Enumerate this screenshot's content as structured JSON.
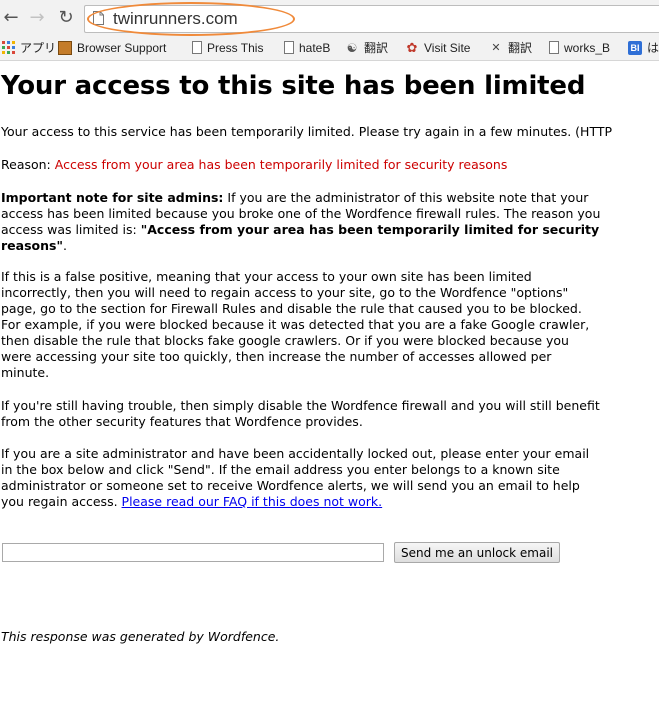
{
  "browser": {
    "url": "twinrunners.com",
    "bookmarks": [
      {
        "label": "アプリ",
        "icon": "apps-grid-icon"
      },
      {
        "label": "Browser Support",
        "icon": "bookmark-folder-icon"
      },
      {
        "label": "Press This",
        "icon": "page-icon"
      },
      {
        "label": "hateB",
        "icon": "page-icon"
      },
      {
        "label": "翻訳",
        "icon": "translate-icon"
      },
      {
        "label": "Visit Site",
        "icon": "visit-site-icon"
      },
      {
        "label": "翻訳",
        "icon": "translate-x-icon"
      },
      {
        "label": "works_B",
        "icon": "page-icon"
      },
      {
        "label": "は",
        "icon": "bl-icon"
      }
    ],
    "accent_color": "#f08a3a"
  },
  "page": {
    "title": "Your access to this site has been limited",
    "intro": "Your access to this service has been temporarily limited. Please try again in a few minutes. (HTTP",
    "reason_label": "Reason:",
    "reason_text": "Access from your area has been temporarily limited for security reasons",
    "note_label": "Important note for site admins:",
    "note_text_1": "If you are the administrator of this website note that your access has been limited because you broke one of the Wordfence firewall rules. The reason you access was limited is:",
    "note_reason_bold": "\"Access from your area has been temporarily limited for security reasons\"",
    "note_text_2": ".",
    "false_positive": "If this is a false positive, meaning that your access to your own site has been limited incorrectly, then you will need to regain access to your site, go to the Wordfence \"options\" page, go to the section for Firewall Rules and disable the rule that caused you to be blocked. For example, if you were blocked because it was detected that you are a fake Google crawler, then disable the rule that blocks fake google crawlers. Or if you were blocked because you were accessing your site too quickly, then increase the number of accesses allowed per minute.",
    "still_trouble": "If you're still having trouble, then simply disable the Wordfence firewall and you will still benefit from the other security features that Wordfence provides.",
    "locked_out": "If you are a site administrator and have been accidentally locked out, please enter your email in the box below and click \"Send\". If the email address you enter belongs to a known site administrator or someone set to receive Wordfence alerts, we will send you an email to help you regain access.",
    "faq_link": "Please read our FAQ if this does not work.",
    "email_value": "",
    "unlock_button": "Send me an unlock email",
    "footer": "This response was generated by Wordfence.",
    "reason_color": "#cc0000",
    "link_color": "#0000ee"
  }
}
